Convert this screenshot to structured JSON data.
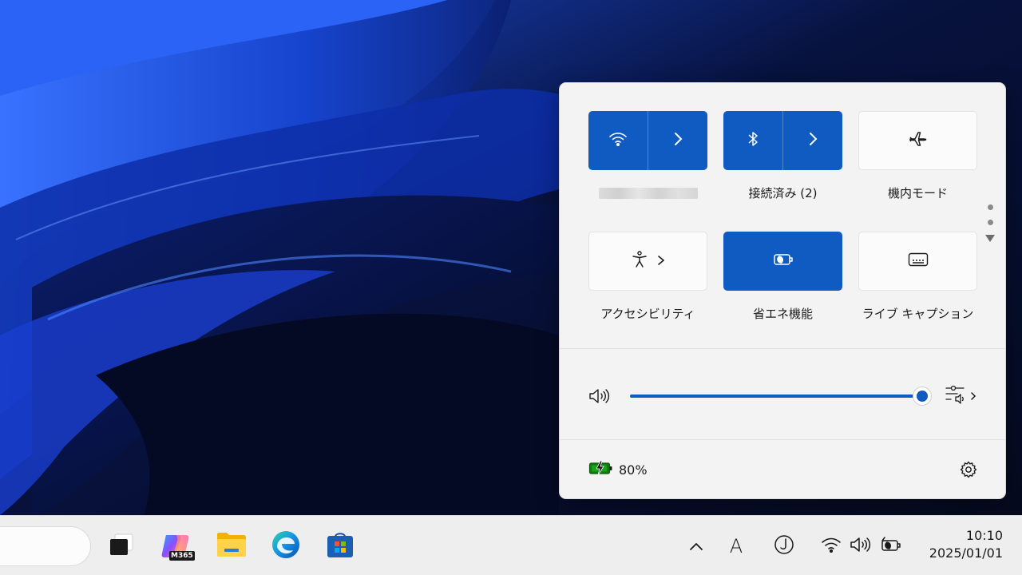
{
  "quick_settings": {
    "tiles": [
      {
        "id": "wifi",
        "label": "",
        "state": "on",
        "icon": "wifi-icon"
      },
      {
        "id": "bluetooth",
        "label": "接続済み (2)",
        "state": "on",
        "icon": "bluetooth-icon"
      },
      {
        "id": "airplane",
        "label": "機内モード",
        "state": "off",
        "icon": "airplane-icon"
      },
      {
        "id": "accessibility",
        "label": "アクセシビリティ",
        "state": "off",
        "icon": "accessibility-icon"
      },
      {
        "id": "energy_saver",
        "label": "省エネ機能",
        "state": "on",
        "icon": "energy-saver-icon"
      },
      {
        "id": "live_captions",
        "label": "ライブ キャプション",
        "state": "off",
        "icon": "captions-icon"
      }
    ],
    "volume": {
      "level": 100,
      "icon": "speaker-icon"
    },
    "battery": {
      "percent_label": "80%",
      "icon": "battery-charging-icon"
    },
    "settings_icon": "gear-icon"
  },
  "taskbar": {
    "apps": [
      "task-view-icon",
      "m365-copilot-icon",
      "file-explorer-icon",
      "edge-icon",
      "store-icon"
    ],
    "m365_badge": "M365",
    "ime_label": "A",
    "clock": {
      "time": "10:10",
      "date": "2025/01/01"
    }
  },
  "colors": {
    "accent": "#0f5bc1",
    "panel_bg": "#f3f3f3",
    "taskbar_bg": "#eeeeee"
  }
}
